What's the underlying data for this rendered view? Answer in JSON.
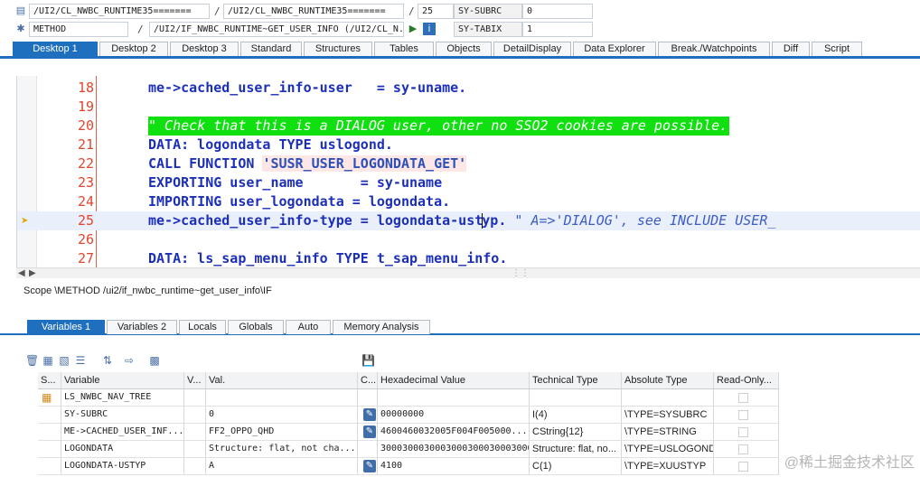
{
  "header": {
    "row1": {
      "field_a": "/UI2/CL_NWBC_RUNTIME35=======",
      "field_b": "/UI2/CL_NWBC_RUNTIME35=======",
      "line": "25",
      "var_name": "SY-SUBRC",
      "var_value": "0"
    },
    "row2": {
      "type": "METHOD",
      "method": "/UI2/IF_NWBC_RUNTIME~GET_USER_INFO (/UI2/CL_N...",
      "var_name": "SY-TABIX",
      "var_value": "1"
    },
    "slash": "/"
  },
  "top_tabs": [
    "Desktop 1",
    "Desktop 2",
    "Desktop 3",
    "Standard",
    "Structures",
    "Tables",
    "Objects",
    "DetailDisplay",
    "Data Explorer",
    "Break./Watchpoints",
    "Diff",
    "Script"
  ],
  "code_lines": [
    {
      "num": "18",
      "text": "me->cached_user_info-user   = sy-uname."
    },
    {
      "num": "19",
      "text": ""
    },
    {
      "num": "20",
      "text": "\" Check that this is a DIALOG user, other no SSO2 cookies are possible."
    },
    {
      "num": "21",
      "text": "DATA: logondata TYPE uslogond."
    },
    {
      "num": "22",
      "pre": "CALL FUNCTION ",
      "str": "'SUSR_USER_LOGONDATA_GET'"
    },
    {
      "num": "23",
      "text": "EXPORTING user_name       = sy-uname"
    },
    {
      "num": "24",
      "text": "IMPORTING user_logondata = logondata."
    },
    {
      "num": "25",
      "pre": "me->cached_user_info-type = logondata-ust",
      "post": "yp. ",
      "cmt": "\" A=>'DIALOG', see INCLUDE USER_"
    },
    {
      "num": "26",
      "text": ""
    },
    {
      "num": "27",
      "text": "DATA: ls_sap_menu_info TYPE t_sap_menu_info."
    }
  ],
  "scope_text": "Scope \\METHOD /ui2/if_nwbc_runtime~get_user_info\\IF",
  "var_tabs": [
    "Variables 1",
    "Variables 2",
    "Locals",
    "Globals",
    "Auto",
    "Memory Analysis"
  ],
  "grid": {
    "headers": [
      "S...",
      "Variable",
      "V...",
      "Val.",
      "C...",
      "Hexadecimal Value",
      "Technical Type",
      "Absolute Type",
      "Read-Only..."
    ],
    "rows": [
      {
        "variable": "LS_NWBC_NAV_TREE",
        "value": "",
        "hex": "",
        "tech": "",
        "abs": ""
      },
      {
        "variable": "SY-SUBRC",
        "value": "0",
        "hex": "00000000",
        "tech": "I(4)",
        "abs": "\\TYPE=SYSUBRC"
      },
      {
        "variable": "ME->CACHED_USER_INF...",
        "value": "FF2_OPPO_QHD",
        "hex": "4600460032005F004F005000...",
        "tech": "CString{12}",
        "abs": "\\TYPE=STRING"
      },
      {
        "variable": "LOGONDATA",
        "value": "Structure: flat, not cha...",
        "hex": "30003000300030003000300030003000...",
        "tech": "Structure: flat, no...",
        "abs": "\\TYPE=USLOGOND"
      },
      {
        "variable": "LOGONDATA-USTYP",
        "value": "A",
        "hex": "4100",
        "tech": "C(1)",
        "abs": "\\TYPE=XUUSTYP"
      }
    ]
  },
  "watermark": "@稀土掘金技术社区",
  "icons": {
    "toolbar": [
      "delete-icon",
      "insert-icon",
      "copy-icon",
      "list-icon",
      "sort-icon",
      "transfer-icon",
      "tree-icon"
    ],
    "save": "save-icon"
  },
  "colors": {
    "accent": "#1f6fbf",
    "line_number": "#e4442c",
    "keyword": "#1c2fb8",
    "comment_highlight": "#10e010"
  }
}
